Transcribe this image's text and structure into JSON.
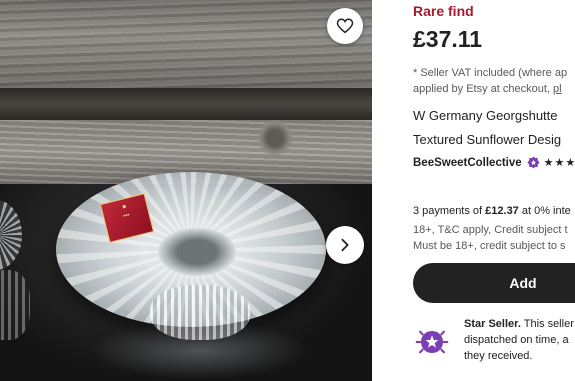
{
  "listing": {
    "rare_label": "Rare find",
    "price": "£37.11",
    "vat_line1": "* Seller VAT included (where ap",
    "vat_line2_prefix": "applied by Etsy at checkout, ",
    "vat_line2_link": "pl",
    "title_line1": "W Germany Georgshutte",
    "title_line2": "Textured Sunflower Desig"
  },
  "shop": {
    "name": "BeeSweetCollective",
    "badge_icon": "star-seller-badge-icon",
    "stars": "★★★"
  },
  "installments": {
    "prefix": "3 payments of ",
    "amount": "£12.37",
    "suffix": " at 0% inte",
    "terms_line1": "18+, T&C apply, Credit subject t",
    "terms_line2": "Must be 18+, credit subject to s"
  },
  "actions": {
    "add_to_basket": "Add",
    "favorite_icon": "heart-icon",
    "next_icon": "chevron-right-icon"
  },
  "star_seller": {
    "title": "Star Seller.",
    "line1_suffix": " This seller",
    "line2": "dispatched on time, a",
    "line3": "they received."
  },
  "colors": {
    "rare": "#a61a2e",
    "button": "#222222",
    "badge": "#7b3fb5"
  }
}
